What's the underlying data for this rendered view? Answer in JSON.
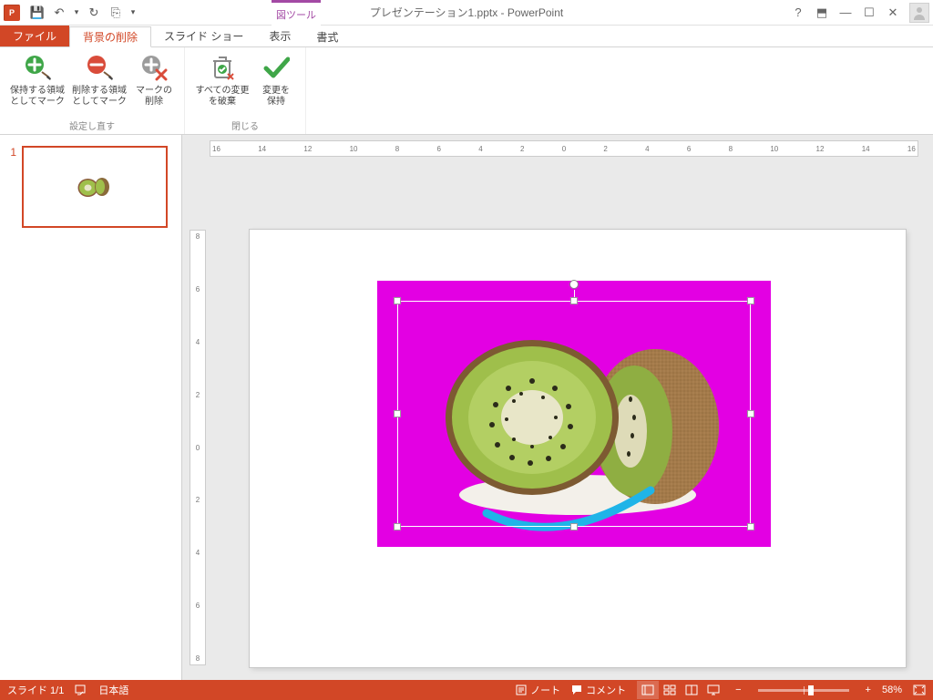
{
  "title": {
    "tool_tab": "図ツール",
    "doc": "プレゼンテーション1.pptx - PowerPoint"
  },
  "tabs": {
    "file": "ファイル",
    "bg_remove": "背景の削除",
    "slideshow": "スライド ショー",
    "view": "表示",
    "format": "書式"
  },
  "ribbon": {
    "mark_keep": "保持する領域\nとしてマーク",
    "mark_remove": "削除する領域\nとしてマーク",
    "delete_mark": "マークの\n削除",
    "discard_all": "すべての変更\nを破棄",
    "keep_changes": "変更を\n保持",
    "group_refine": "設定し直す",
    "group_close": "閉じる"
  },
  "thumb": {
    "num": "1"
  },
  "ruler": {
    "h": [
      "16",
      "14",
      "12",
      "10",
      "8",
      "6",
      "4",
      "2",
      "0",
      "2",
      "4",
      "6",
      "8",
      "10",
      "12",
      "14",
      "16"
    ],
    "v": [
      "8",
      "6",
      "4",
      "2",
      "0",
      "2",
      "4",
      "6",
      "8"
    ]
  },
  "status": {
    "slide": "スライド 1/1",
    "lang": "日本語",
    "notes": "ノート",
    "comments": "コメント",
    "zoom_minus": "−",
    "zoom_plus": "+",
    "zoom": "58%"
  },
  "icons": {
    "save": "💾",
    "undo": "↶",
    "redo": "↻",
    "start": "⎘",
    "dropdown": "▾",
    "help": "?",
    "ribbon_opts": "⬒",
    "min": "—",
    "max": "☐",
    "close": "✕"
  }
}
